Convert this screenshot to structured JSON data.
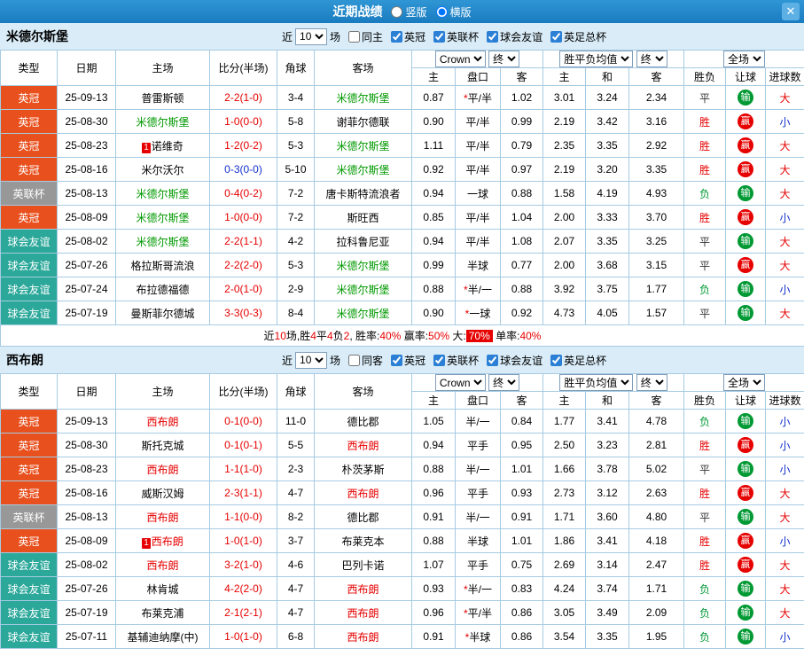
{
  "topbar": {
    "title": "近期战绩",
    "layout_options": [
      {
        "label": "竖版",
        "selected": false
      },
      {
        "label": "横版",
        "selected": true
      }
    ],
    "close_glyph": "✕"
  },
  "filter": {
    "near": "近",
    "count": "10",
    "matches": "场",
    "leagues": [
      "英冠",
      "英联杯",
      "球会友谊",
      "英足总杯"
    ]
  },
  "table_header": {
    "type": "类型",
    "date": "日期",
    "home": "主场",
    "score": "比分(半场)",
    "corner": "角球",
    "away": "客场",
    "bookmaker_select": "Crown",
    "final_select": "终",
    "avg_select": "胜平负均值",
    "fullmatch_select": "全场",
    "sub": [
      "主",
      "盘口",
      "客",
      "主",
      "和",
      "客",
      "胜负",
      "让球",
      "进球数"
    ]
  },
  "colors": {
    "accent_blue": "#1e87c9",
    "win_red": "#e60000",
    "lose_green": "#009933",
    "under_blue": "#1430cc",
    "league_championship": "#e8501e",
    "league_cup": "#989898",
    "league_friendly": "#2ca89a"
  },
  "sections": [
    {
      "team": "米德尔斯堡",
      "focus_color": "#009900",
      "same_label": "同主",
      "rows": [
        {
          "lg": "英冠",
          "date": "25-09-13",
          "home": "普雷斯顿",
          "hf": false,
          "hb": "",
          "score": "2-2(1-0)",
          "sc": "red",
          "cn": "3-4",
          "away": "米德尔斯堡",
          "af": true,
          "ab": "",
          "o1": "0.87",
          "pk": "*平/半",
          "o2": "1.02",
          "m1": "3.01",
          "m2": "3.24",
          "m3": "2.34",
          "spf": "平",
          "rq": "输",
          "jq": "大"
        },
        {
          "lg": "英冠",
          "date": "25-08-30",
          "home": "米德尔斯堡",
          "hf": true,
          "hb": "",
          "score": "1-0(0-0)",
          "sc": "red",
          "cn": "5-8",
          "away": "谢菲尔德联",
          "af": false,
          "ab": "",
          "o1": "0.90",
          "pk": "平/半",
          "o2": "0.99",
          "m1": "2.19",
          "m2": "3.42",
          "m3": "3.16",
          "spf": "胜",
          "rq": "赢",
          "jq": "小"
        },
        {
          "lg": "英冠",
          "date": "25-08-23",
          "home": "诺维奇",
          "hf": false,
          "hb": "1",
          "score": "1-2(0-2)",
          "sc": "red",
          "cn": "5-3",
          "away": "米德尔斯堡",
          "af": true,
          "ab": "",
          "o1": "1.11",
          "pk": "平/半",
          "o2": "0.79",
          "m1": "2.35",
          "m2": "3.35",
          "m3": "2.92",
          "spf": "胜",
          "rq": "赢",
          "jq": "大"
        },
        {
          "lg": "英冠",
          "date": "25-08-16",
          "home": "米尔沃尔",
          "hf": false,
          "hb": "",
          "score": "0-3(0-0)",
          "sc": "blue",
          "cn": "5-10",
          "away": "米德尔斯堡",
          "af": true,
          "ab": "",
          "o1": "0.92",
          "pk": "平/半",
          "o2": "0.97",
          "m1": "2.19",
          "m2": "3.20",
          "m3": "3.35",
          "spf": "胜",
          "rq": "赢",
          "jq": "大"
        },
        {
          "lg": "英联杯",
          "date": "25-08-13",
          "home": "米德尔斯堡",
          "hf": true,
          "hb": "",
          "score": "0-4(0-2)",
          "sc": "red",
          "cn": "7-2",
          "away": "唐卡斯特流浪者",
          "af": false,
          "ab": "",
          "o1": "0.94",
          "pk": "一球",
          "o2": "0.88",
          "m1": "1.58",
          "m2": "4.19",
          "m3": "4.93",
          "spf": "负",
          "rq": "输",
          "jq": "大"
        },
        {
          "lg": "英冠",
          "date": "25-08-09",
          "home": "米德尔斯堡",
          "hf": true,
          "hb": "",
          "score": "1-0(0-0)",
          "sc": "red",
          "cn": "7-2",
          "away": "斯旺西",
          "af": false,
          "ab": "",
          "o1": "0.85",
          "pk": "平/半",
          "o2": "1.04",
          "m1": "2.00",
          "m2": "3.33",
          "m3": "3.70",
          "spf": "胜",
          "rq": "赢",
          "jq": "小"
        },
        {
          "lg": "球会友谊",
          "date": "25-08-02",
          "home": "米德尔斯堡",
          "hf": true,
          "hb": "",
          "score": "2-2(1-1)",
          "sc": "red",
          "cn": "4-2",
          "away": "拉科鲁尼亚",
          "af": false,
          "ab": "",
          "o1": "0.94",
          "pk": "平/半",
          "o2": "1.08",
          "m1": "2.07",
          "m2": "3.35",
          "m3": "3.25",
          "spf": "平",
          "rq": "输",
          "jq": "大"
        },
        {
          "lg": "球会友谊",
          "date": "25-07-26",
          "home": "格拉斯哥流浪",
          "hf": false,
          "hb": "",
          "score": "2-2(2-0)",
          "sc": "red",
          "cn": "5-3",
          "away": "米德尔斯堡",
          "af": true,
          "ab": "",
          "o1": "0.99",
          "pk": "半球",
          "o2": "0.77",
          "m1": "2.00",
          "m2": "3.68",
          "m3": "3.15",
          "spf": "平",
          "rq": "赢",
          "jq": "大"
        },
        {
          "lg": "球会友谊",
          "date": "25-07-24",
          "home": "布拉德福德",
          "hf": false,
          "hb": "",
          "score": "2-0(1-0)",
          "sc": "red",
          "cn": "2-9",
          "away": "米德尔斯堡",
          "af": true,
          "ab": "",
          "o1": "0.88",
          "pk": "*半/一",
          "o2": "0.88",
          "m1": "3.92",
          "m2": "3.75",
          "m3": "1.77",
          "spf": "负",
          "rq": "输",
          "jq": "小"
        },
        {
          "lg": "球会友谊",
          "date": "25-07-19",
          "home": "曼斯菲尔德城",
          "hf": false,
          "hb": "",
          "score": "3-3(0-3)",
          "sc": "red",
          "cn": "8-4",
          "away": "米德尔斯堡",
          "af": true,
          "ab": "",
          "o1": "0.90",
          "pk": "*一球",
          "o2": "0.92",
          "m1": "4.73",
          "m2": "4.05",
          "m3": "1.57",
          "spf": "平",
          "rq": "输",
          "jq": "大"
        }
      ],
      "summary": [
        {
          "t": "近"
        },
        {
          "t": "10",
          "c": "red"
        },
        {
          "t": "场,胜"
        },
        {
          "t": "4",
          "c": "red"
        },
        {
          "t": "平"
        },
        {
          "t": "4",
          "c": "red"
        },
        {
          "t": "负"
        },
        {
          "t": "2",
          "c": "red"
        },
        {
          "t": ", 胜率:"
        },
        {
          "t": "40%",
          "c": "red"
        },
        {
          "t": " 赢率:"
        },
        {
          "t": "50%",
          "c": "red"
        },
        {
          "t": " 大:"
        },
        {
          "t": "70%",
          "c": "badge"
        },
        {
          "t": " 单率:"
        },
        {
          "t": "40%",
          "c": "red"
        }
      ]
    },
    {
      "team": "西布朗",
      "focus_color": "#e60000",
      "same_label": "同客",
      "rows": [
        {
          "lg": "英冠",
          "date": "25-09-13",
          "home": "西布朗",
          "hf": true,
          "hb": "",
          "score": "0-1(0-0)",
          "sc": "red",
          "cn": "11-0",
          "away": "德比郡",
          "af": false,
          "ab": "",
          "o1": "1.05",
          "pk": "半/一",
          "o2": "0.84",
          "m1": "1.77",
          "m2": "3.41",
          "m3": "4.78",
          "spf": "负",
          "rq": "输",
          "jq": "小"
        },
        {
          "lg": "英冠",
          "date": "25-08-30",
          "home": "斯托克城",
          "hf": false,
          "hb": "",
          "score": "0-1(0-1)",
          "sc": "red",
          "cn": "5-5",
          "away": "西布朗",
          "af": true,
          "ab": "",
          "o1": "0.94",
          "pk": "平手",
          "o2": "0.95",
          "m1": "2.50",
          "m2": "3.23",
          "m3": "2.81",
          "spf": "胜",
          "rq": "赢",
          "jq": "小"
        },
        {
          "lg": "英冠",
          "date": "25-08-23",
          "home": "西布朗",
          "hf": true,
          "hb": "",
          "score": "1-1(1-0)",
          "sc": "red",
          "cn": "2-3",
          "away": "朴茨茅斯",
          "af": false,
          "ab": "",
          "o1": "0.88",
          "pk": "半/一",
          "o2": "1.01",
          "m1": "1.66",
          "m2": "3.78",
          "m3": "5.02",
          "spf": "平",
          "rq": "输",
          "jq": "小"
        },
        {
          "lg": "英冠",
          "date": "25-08-16",
          "home": "威斯汉姆",
          "hf": false,
          "hb": "",
          "score": "2-3(1-1)",
          "sc": "red",
          "cn": "4-7",
          "away": "西布朗",
          "af": true,
          "ab": "",
          "o1": "0.96",
          "pk": "平手",
          "o2": "0.93",
          "m1": "2.73",
          "m2": "3.12",
          "m3": "2.63",
          "spf": "胜",
          "rq": "赢",
          "jq": "大"
        },
        {
          "lg": "英联杯",
          "date": "25-08-13",
          "home": "西布朗",
          "hf": true,
          "hb": "",
          "score": "1-1(0-0)",
          "sc": "red",
          "cn": "8-2",
          "away": "德比郡",
          "af": false,
          "ab": "",
          "o1": "0.91",
          "pk": "半/一",
          "o2": "0.91",
          "m1": "1.71",
          "m2": "3.60",
          "m3": "4.80",
          "spf": "平",
          "rq": "输",
          "jq": "大"
        },
        {
          "lg": "英冠",
          "date": "25-08-09",
          "home": "西布朗",
          "hf": true,
          "hb": "1",
          "score": "1-0(1-0)",
          "sc": "red",
          "cn": "3-7",
          "away": "布莱克本",
          "af": false,
          "ab": "",
          "o1": "0.88",
          "pk": "半球",
          "o2": "1.01",
          "m1": "1.86",
          "m2": "3.41",
          "m3": "4.18",
          "spf": "胜",
          "rq": "赢",
          "jq": "小"
        },
        {
          "lg": "球会友谊",
          "date": "25-08-02",
          "home": "西布朗",
          "hf": true,
          "hb": "",
          "score": "3-2(1-0)",
          "sc": "red",
          "cn": "4-6",
          "away": "巴列卡诺",
          "af": false,
          "ab": "",
          "o1": "1.07",
          "pk": "平手",
          "o2": "0.75",
          "m1": "2.69",
          "m2": "3.14",
          "m3": "2.47",
          "spf": "胜",
          "rq": "赢",
          "jq": "大"
        },
        {
          "lg": "球会友谊",
          "date": "25-07-26",
          "home": "林肯城",
          "hf": false,
          "hb": "",
          "score": "4-2(2-0)",
          "sc": "red",
          "cn": "4-7",
          "away": "西布朗",
          "af": true,
          "ab": "",
          "o1": "0.93",
          "pk": "*半/一",
          "o2": "0.83",
          "m1": "4.24",
          "m2": "3.74",
          "m3": "1.71",
          "spf": "负",
          "rq": "输",
          "jq": "大"
        },
        {
          "lg": "球会友谊",
          "date": "25-07-19",
          "home": "布莱克浦",
          "hf": false,
          "hb": "",
          "score": "2-1(2-1)",
          "sc": "red",
          "cn": "4-7",
          "away": "西布朗",
          "af": true,
          "ab": "",
          "o1": "0.96",
          "pk": "*平/半",
          "o2": "0.86",
          "m1": "3.05",
          "m2": "3.49",
          "m3": "2.09",
          "spf": "负",
          "rq": "输",
          "jq": "大"
        },
        {
          "lg": "球会友谊",
          "date": "25-07-11",
          "home": "基辅迪纳摩(中)",
          "hf": false,
          "hb": "",
          "score": "1-0(1-0)",
          "sc": "red",
          "cn": "6-8",
          "away": "西布朗",
          "af": true,
          "ab": "",
          "o1": "0.91",
          "pk": "*半球",
          "o2": "0.86",
          "m1": "3.54",
          "m2": "3.35",
          "m3": "1.95",
          "spf": "负",
          "rq": "输",
          "jq": "小"
        }
      ]
    }
  ]
}
